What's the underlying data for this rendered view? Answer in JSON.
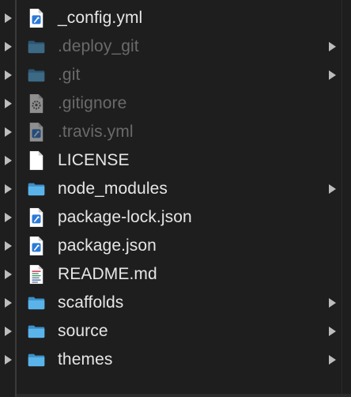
{
  "finder": {
    "items": [
      {
        "name": "_config.yml",
        "kind": "xcode-doc",
        "hidden": false,
        "folder": false
      },
      {
        "name": ".deploy_git",
        "kind": "folder",
        "hidden": true,
        "folder": true
      },
      {
        "name": ".git",
        "kind": "folder",
        "hidden": true,
        "folder": true
      },
      {
        "name": ".gitignore",
        "kind": "settings-doc",
        "hidden": true,
        "folder": false
      },
      {
        "name": ".travis.yml",
        "kind": "xcode-doc",
        "hidden": true,
        "folder": false
      },
      {
        "name": "LICENSE",
        "kind": "blank-doc",
        "hidden": false,
        "folder": false
      },
      {
        "name": "node_modules",
        "kind": "folder",
        "hidden": false,
        "folder": true
      },
      {
        "name": "package-lock.json",
        "kind": "xcode-doc",
        "hidden": false,
        "folder": false
      },
      {
        "name": "package.json",
        "kind": "xcode-doc",
        "hidden": false,
        "folder": false
      },
      {
        "name": "README.md",
        "kind": "text-doc",
        "hidden": false,
        "folder": false
      },
      {
        "name": "scaffolds",
        "kind": "folder",
        "hidden": false,
        "folder": true
      },
      {
        "name": "source",
        "kind": "folder",
        "hidden": false,
        "folder": true
      },
      {
        "name": "themes",
        "kind": "folder",
        "hidden": false,
        "folder": true
      }
    ]
  },
  "colors": {
    "background": "#1e1e1e",
    "text": "#e6e6e6",
    "hidden_text": "#6a6a6a",
    "folder": "#4aa8e0",
    "arrow": "#bdbdbd"
  }
}
